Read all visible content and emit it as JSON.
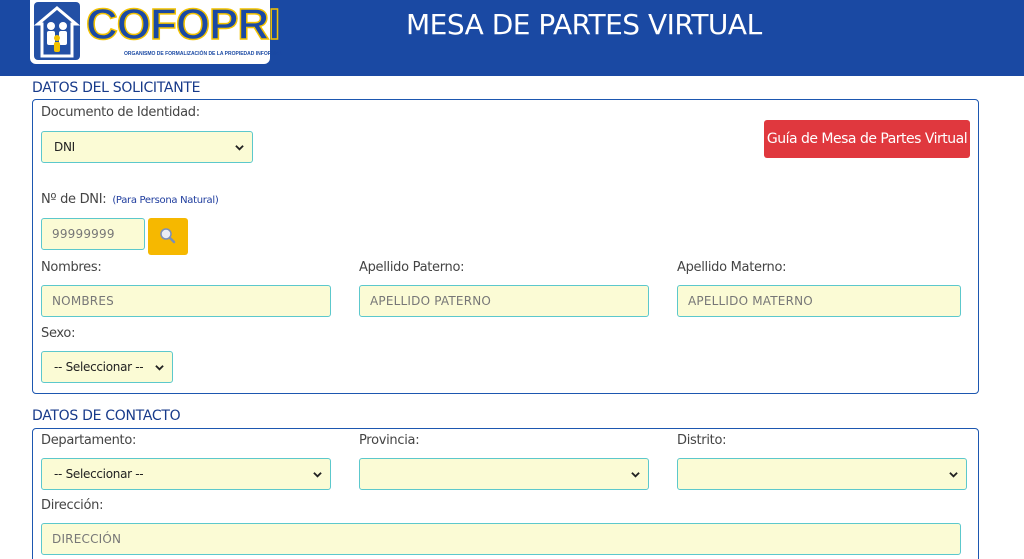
{
  "header": {
    "logo_text": "COFOPRI",
    "logo_subtitle": "ORGANISMO DE FORMALIZACIÓN DE LA PROPIEDAD INFORMAL",
    "title": "MESA DE PARTES VIRTUAL"
  },
  "solicitante": {
    "section_title": "DATOS DEL SOLICITANTE",
    "doc_label": "Documento de Identidad:",
    "doc_value": "DNI",
    "guide_button": "Guía de Mesa de Partes Virtual",
    "dni_label": "Nº de DNI:",
    "dni_hint": "(Para Persona Natural)",
    "dni_placeholder": "99999999",
    "nombres_label": "Nombres:",
    "nombres_placeholder": "NOMBRES",
    "paterno_label": "Apellido Paterno:",
    "paterno_placeholder": "APELLIDO PATERNO",
    "materno_label": "Apellido Materno:",
    "materno_placeholder": "APELLIDO MATERNO",
    "sexo_label": "Sexo:",
    "sexo_value": "-- Seleccionar --"
  },
  "contacto": {
    "section_title": "DATOS DE CONTACTO",
    "departamento_label": "Departamento:",
    "departamento_value": "-- Seleccionar --",
    "provincia_label": "Provincia:",
    "provincia_value": "",
    "distrito_label": "Distrito:",
    "distrito_value": "",
    "direccion_label": "Dirección:",
    "direccion_placeholder": "DIRECCIÓN"
  },
  "colors": {
    "header_bg": "#1a49a3",
    "field_bg": "#fbfbd5",
    "field_border": "#5cc8cc",
    "guide_button_bg": "#e0383e",
    "search_button_bg": "#f6b800"
  },
  "icons": {
    "search": "magnifier-icon",
    "select_arrow": "chevron-down-icon",
    "logo": "family-house-icon"
  }
}
